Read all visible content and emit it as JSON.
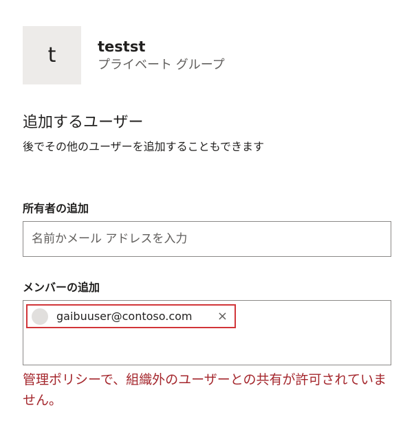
{
  "group": {
    "avatar_initial": "t",
    "name": "testst",
    "type": "プライベート グループ"
  },
  "section": {
    "title": "追加するユーザー",
    "description": "後でその他のユーザーを追加することもできます"
  },
  "owners": {
    "label": "所有者の追加",
    "placeholder": "名前かメール アドレスを入力"
  },
  "members": {
    "label": "メンバーの追加",
    "chips": [
      {
        "email": "gaibuuser@contoso.com",
        "remove_glyph": "×"
      }
    ]
  },
  "error": {
    "message": "管理ポリシーで、組織外のユーザーとの共有が許可されていません。"
  },
  "colors": {
    "error": "#a4262c",
    "chip_border": "#d13438",
    "avatar_bg": "#edebe9"
  }
}
